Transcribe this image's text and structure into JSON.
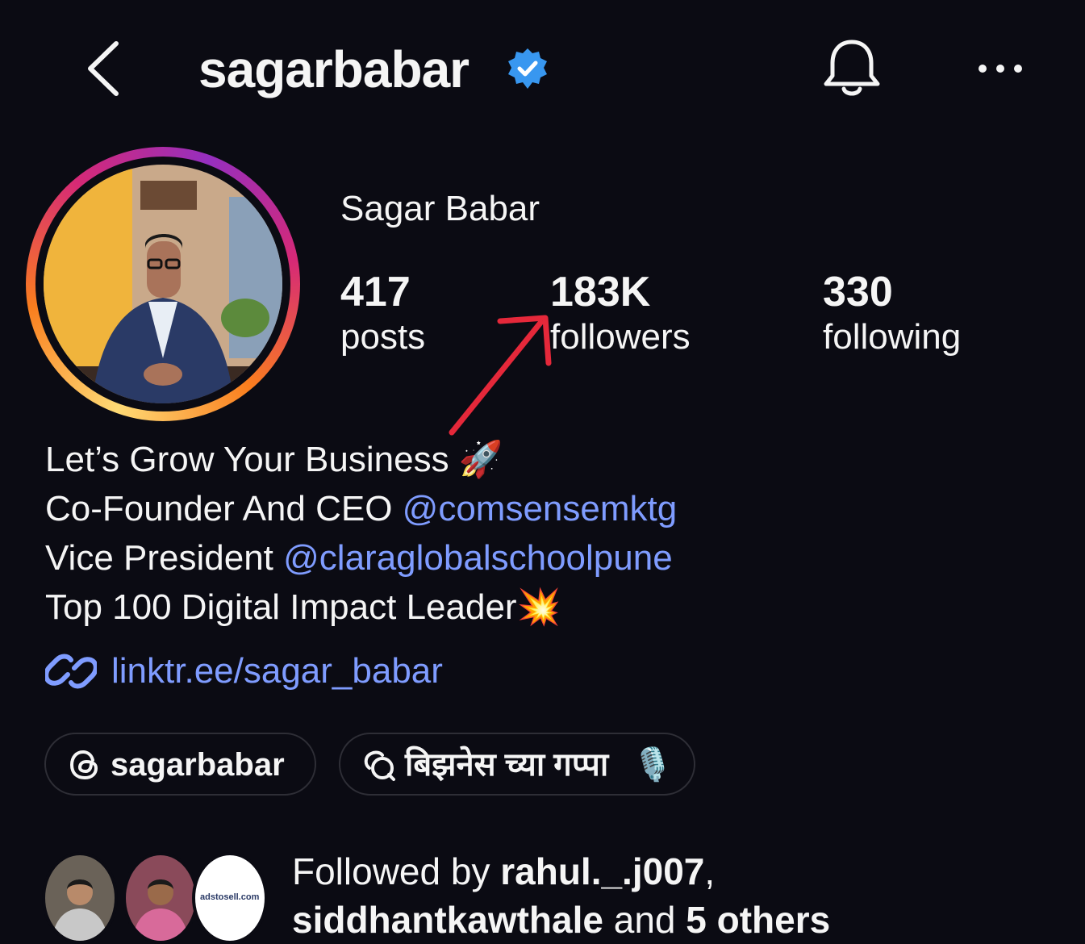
{
  "header": {
    "username": "sagarbabar",
    "icons": {
      "back": "chevron-left-icon",
      "verified": "verified-badge-icon",
      "bell": "bell-icon",
      "more": "more-horizontal-icon"
    }
  },
  "profile": {
    "full_name": "Sagar Babar",
    "stats": {
      "posts": {
        "count": "417",
        "label": "posts"
      },
      "followers": {
        "count": "183K",
        "label": "followers"
      },
      "following": {
        "count": "330",
        "label": "following"
      }
    }
  },
  "bio": {
    "line1": "Let’s Grow Your Business",
    "line1_emoji": "🚀",
    "line2_prefix": "Co-Founder And CEO ",
    "line2_mention": "@comsensemktg",
    "line3_prefix": "Vice President ",
    "line3_mention": "@claraglobalschoolpune",
    "line4": "Top 100 Digital Impact Leader",
    "line4_emoji": "💥",
    "link": "linktr.ee/sagar_babar"
  },
  "chips": {
    "threads": "sagarbabar",
    "group": "बिझनेस च्या गप्पा",
    "group_emoji": "🎙️"
  },
  "followed_by": {
    "prefix": "Followed by ",
    "user1": "rahul._.j007",
    "comma": ",",
    "user2": "siddhantkawthale",
    "middle": " and ",
    "others": "5 others",
    "third_avatar_text": "adstosell.com"
  },
  "colors": {
    "background": "#0b0b13",
    "mention": "#7f9cff",
    "verified": "#3897f0",
    "annotation_arrow": "#e5283a"
  }
}
